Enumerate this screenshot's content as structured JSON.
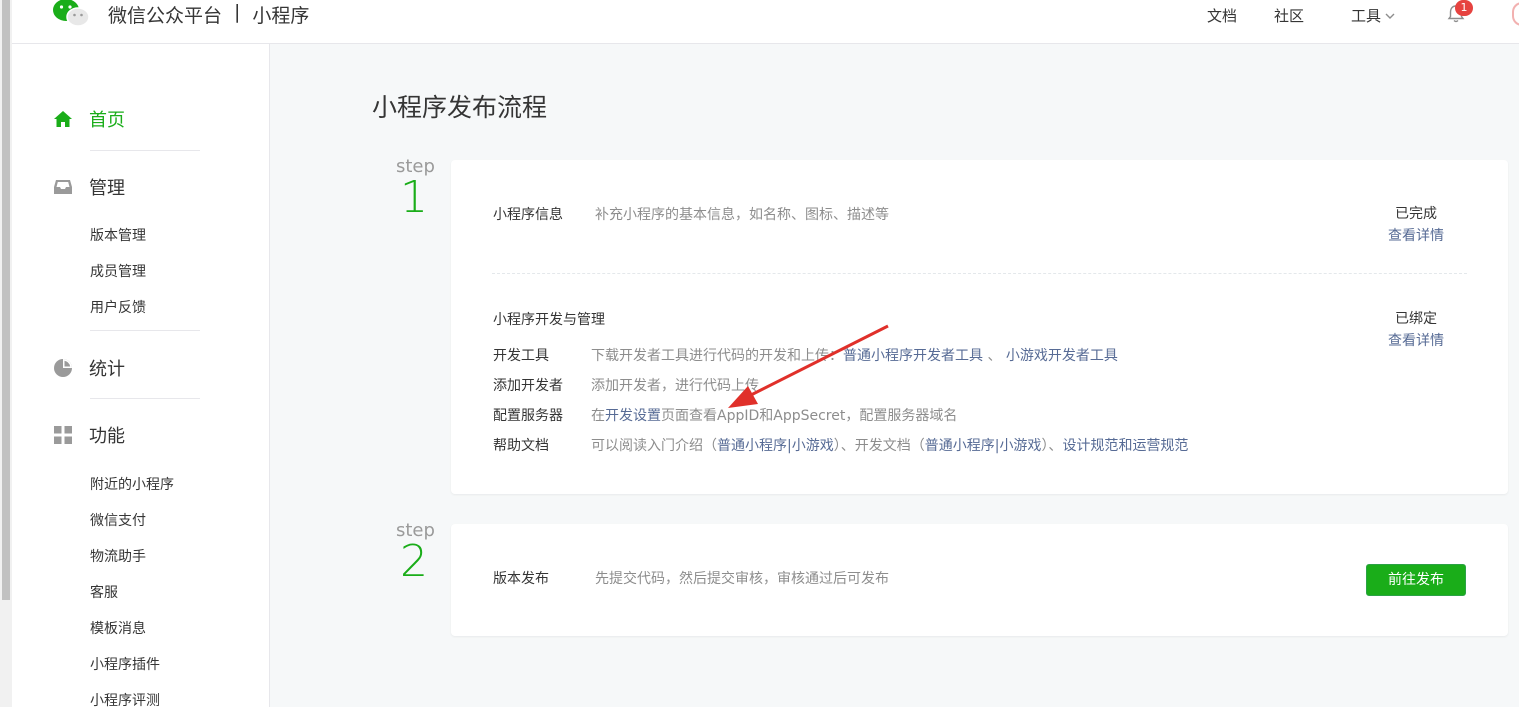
{
  "header": {
    "brand_name": "微信公众平台",
    "brand_sep": "|",
    "brand_product": "小程序",
    "nav_docs": "文档",
    "nav_community": "社区",
    "nav_tools": "工具",
    "notification_count": "1"
  },
  "sidebar": {
    "home": "首页",
    "manage": "管理",
    "manage_items": [
      "版本管理",
      "成员管理",
      "用户反馈"
    ],
    "stats": "统计",
    "features": "功能",
    "feature_items": [
      "附近的小程序",
      "微信支付",
      "物流助手",
      "客服",
      "模板消息",
      "小程序插件",
      "小程序评测"
    ]
  },
  "main": {
    "title": "小程序发布流程",
    "step_word": "step",
    "step1": {
      "number": "1",
      "info_title": "小程序信息",
      "info_desc": "补充小程序的基本信息，如名称、图标、描述等",
      "info_status": "已完成",
      "info_link": "查看详情",
      "dev_title": "小程序开发与管理",
      "dev_status": "已绑定",
      "dev_link": "查看详情",
      "rows": {
        "tools_label": "开发工具",
        "tools_text": "下载开发者工具进行代码的开发和上传：",
        "tools_link1": "普通小程序开发者工具",
        "tools_sep": "、",
        "tools_link2": "小游戏开发者工具",
        "add_label": "添加开发者",
        "add_text": "添加开发者，进行代码上传",
        "server_label": "配置服务器",
        "server_pre": "在",
        "server_link": "开发设置",
        "server_post": "页面查看AppID和AppSecret，配置服务器域名",
        "help_label": "帮助文档",
        "help_pre": "可以阅读入门介绍（",
        "help_link1": "普通小程序",
        "help_bar1": "|",
        "help_link2": "小游戏",
        "help_mid": "）、开发文档（",
        "help_link3": "普通小程序",
        "help_bar2": "|",
        "help_link4": "小游戏",
        "help_mid2": "）、",
        "help_link5": "设计规范",
        "help_and": "和",
        "help_link6": "运营规范"
      }
    },
    "step2": {
      "number": "2",
      "title": "版本发布",
      "desc": "先提交代码，然后提交审核，审核通过后可发布",
      "button": "前往发布"
    }
  },
  "colors": {
    "accent_green": "#1aad19",
    "link_blue": "#576b95",
    "annotation_red": "#e0302a",
    "badge_red": "#e64340"
  }
}
